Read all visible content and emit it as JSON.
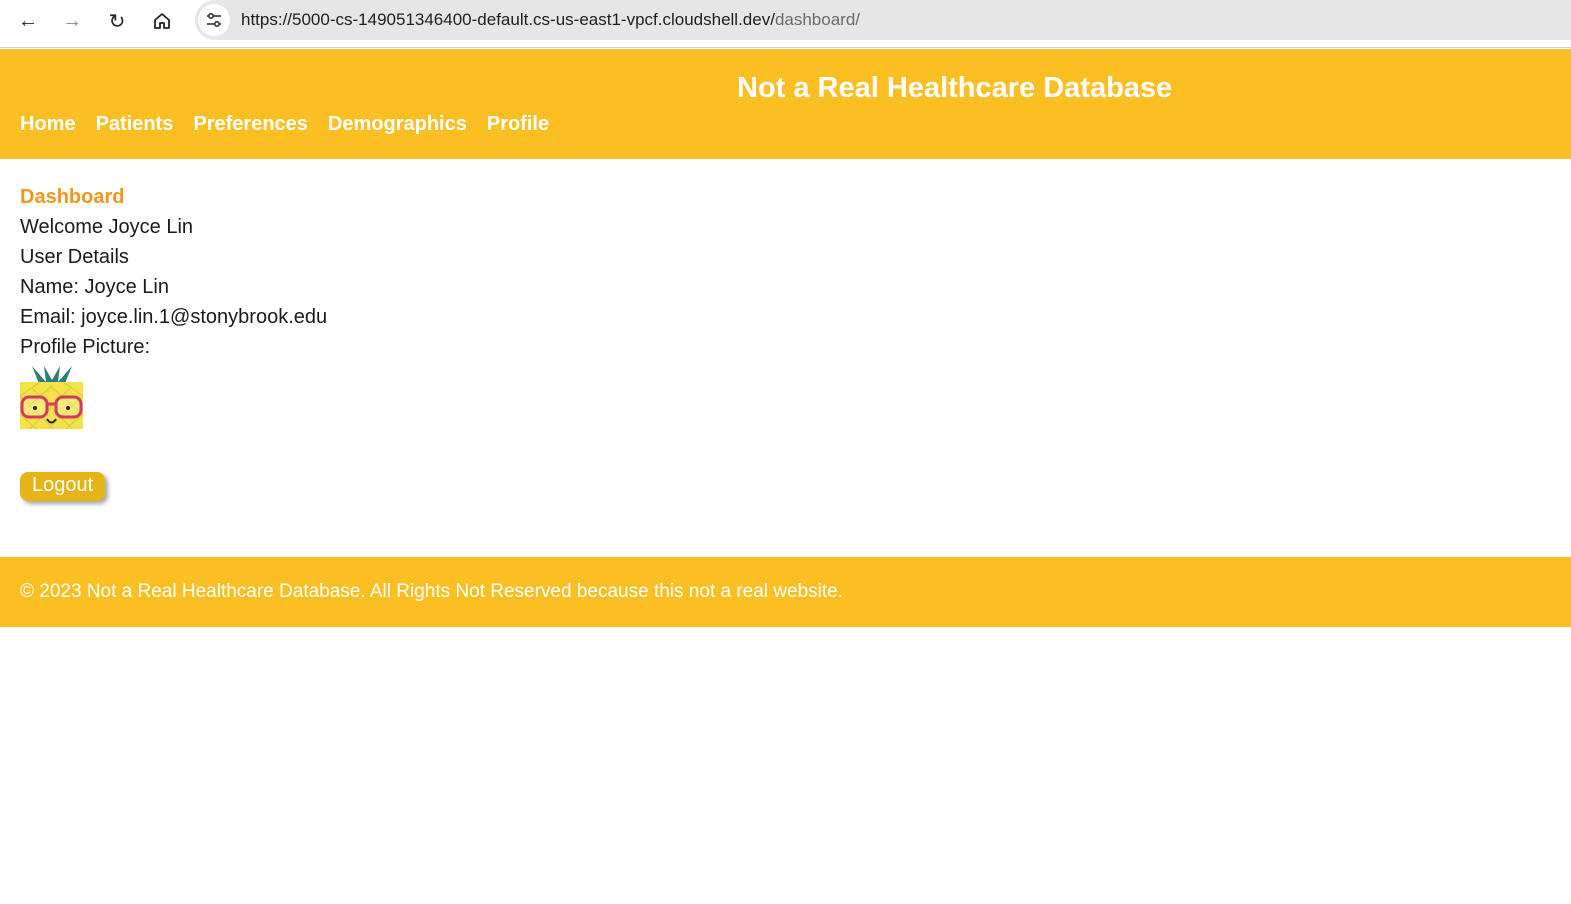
{
  "browser": {
    "url_host": "https://5000-cs-149051346400-default.cs-us-east1-vpcf.cloudshell.dev/",
    "url_path": "dashboard/",
    "icons": [
      "back-arrow-icon",
      "forward-arrow-icon",
      "reload-icon",
      "home-icon",
      "site-settings-icon"
    ]
  },
  "header": {
    "title": "Not a Real Healthcare Database",
    "nav": [
      "Home",
      "Patients",
      "Preferences",
      "Demographics",
      "Profile"
    ]
  },
  "dashboard": {
    "title": "Dashboard",
    "welcome": "Welcome Joyce Lin",
    "details_heading": "User Details",
    "name_line": "Name: Joyce Lin",
    "email_line": "Email: joyce.lin.1@stonybrook.edu",
    "picture_label": "Profile Picture:",
    "logout_label": "Logout"
  },
  "footer": {
    "text": "© 2023 Not a Real Healthcare Database. All Rights Not Reserved because this not a real website."
  },
  "colors": {
    "brand_yellow": "#fbbf24",
    "title_orange": "#f5961a",
    "button_yellow": "#e7b416"
  }
}
